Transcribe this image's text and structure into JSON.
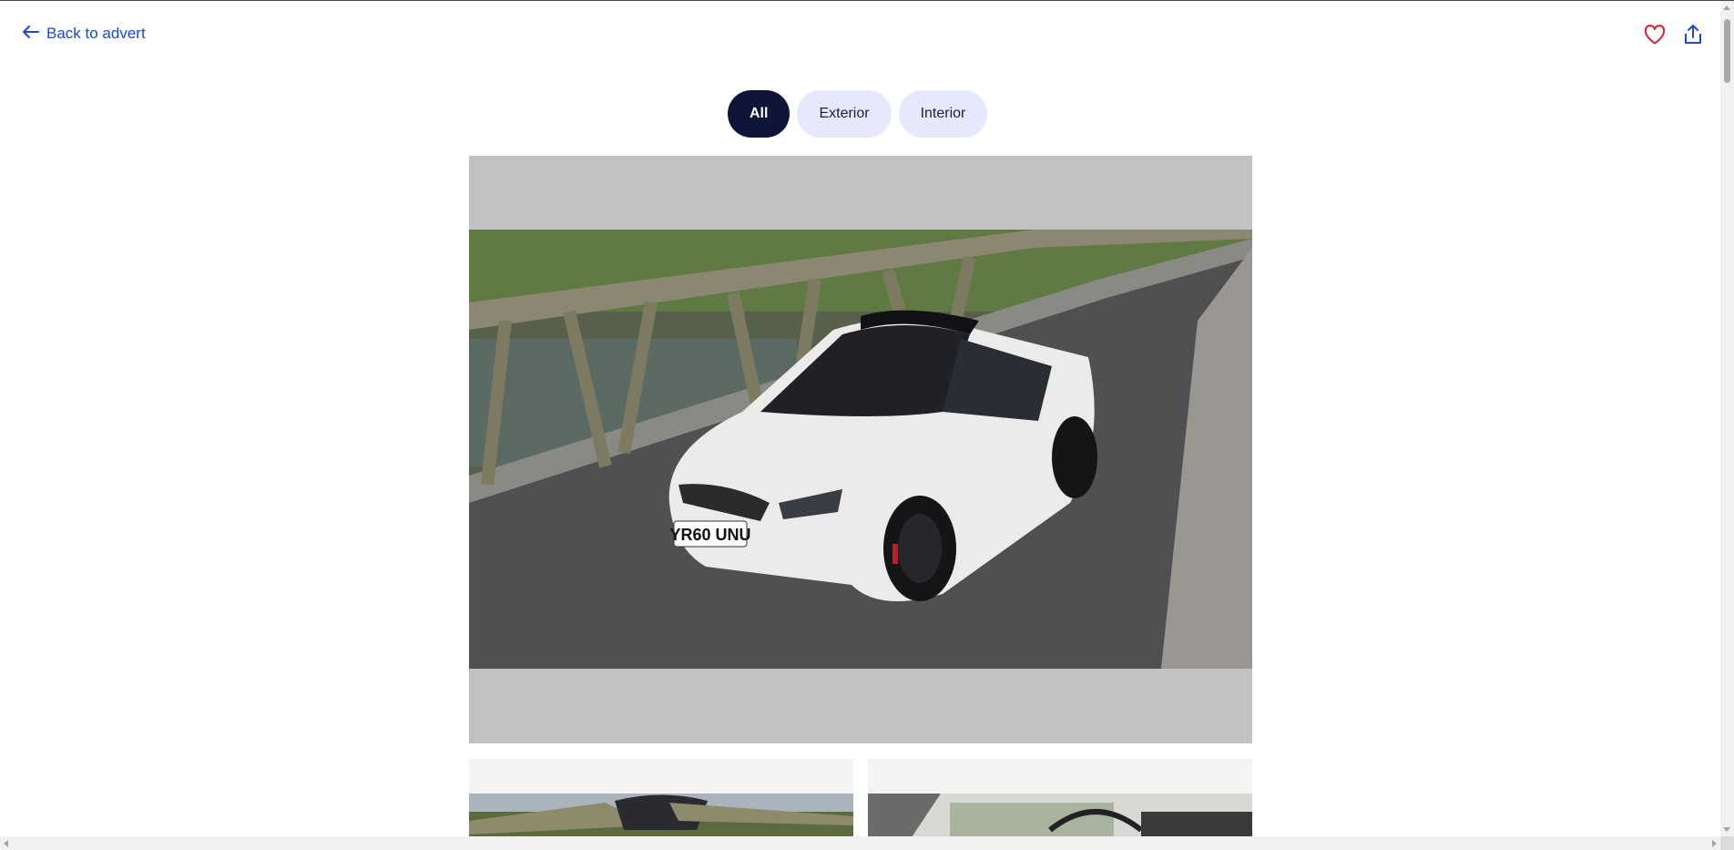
{
  "header": {
    "back_label": "Back to advert",
    "back_icon": "arrow-left-icon",
    "favourite_icon": "heart-icon",
    "share_icon": "share-icon"
  },
  "filters": {
    "tabs": [
      {
        "label": "All",
        "active": true
      },
      {
        "label": "Exterior",
        "active": false
      },
      {
        "label": "Interior",
        "active": false
      }
    ]
  },
  "gallery": {
    "main_photo": {
      "subject": "white hatchback car on bridge",
      "plate": "YR60 UNU"
    },
    "thumbnails": [
      {
        "subject": "car front with bonnet open on bridge"
      },
      {
        "subject": "car interior dashboard"
      }
    ]
  },
  "colors": {
    "link": "#1a47d6",
    "tab_active_bg": "#0e1538",
    "tab_bg": "#e6e8fb",
    "heart": "#e0182d"
  }
}
